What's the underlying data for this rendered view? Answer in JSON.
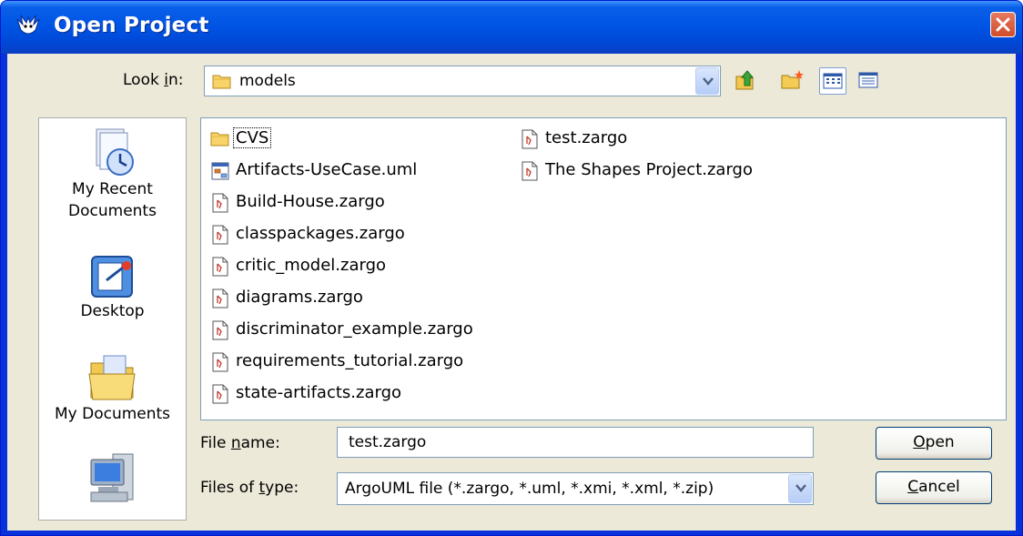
{
  "window": {
    "title": "Open Project"
  },
  "look_in": {
    "label_pre": "Look ",
    "label_key": "i",
    "label_post": "n:",
    "value": "models"
  },
  "places": [
    {
      "label_l1": "My Recent",
      "label_l2": "Documents",
      "icon": "recent-documents-icon"
    },
    {
      "label_l1": "Desktop",
      "label_l2": "",
      "icon": "desktop-icon"
    },
    {
      "label_l1": "My Documents",
      "label_l2": "",
      "icon": "my-documents-icon"
    },
    {
      "label_l1": "",
      "label_l2": "",
      "icon": "my-computer-icon"
    }
  ],
  "files": [
    {
      "name": "CVS",
      "type": "folder"
    },
    {
      "name": "Artifacts-UseCase.uml",
      "type": "uml"
    },
    {
      "name": "Build-House.zargo",
      "type": "zargo"
    },
    {
      "name": "classpackages.zargo",
      "type": "zargo"
    },
    {
      "name": "critic_model.zargo",
      "type": "zargo"
    },
    {
      "name": "diagrams.zargo",
      "type": "zargo"
    },
    {
      "name": "discriminator_example.zargo",
      "type": "zargo"
    },
    {
      "name": "requirements_tutorial.zargo",
      "type": "zargo"
    },
    {
      "name": "state-artifacts.zargo",
      "type": "zargo"
    },
    {
      "name": "test.zargo",
      "type": "zargo"
    },
    {
      "name": "The Shapes Project.zargo",
      "type": "zargo"
    }
  ],
  "file_name": {
    "label_pre": "File ",
    "label_key": "n",
    "label_post": "ame:",
    "value": "test.zargo"
  },
  "file_type": {
    "label_pre": "Files of ",
    "label_key": "t",
    "label_post": "ype:",
    "value": "ArgoUML file (*.zargo, *.uml, *.xmi, *.xml, *.zip)"
  },
  "buttons": {
    "open_key": "O",
    "open_rest": "pen",
    "cancel_key": "C",
    "cancel_rest": "ancel"
  },
  "colors": {
    "title_bar": "#0055e5",
    "dialog_bg": "#ece9d8",
    "field_border": "#7f9db9",
    "close_button": "#d14b2a"
  }
}
